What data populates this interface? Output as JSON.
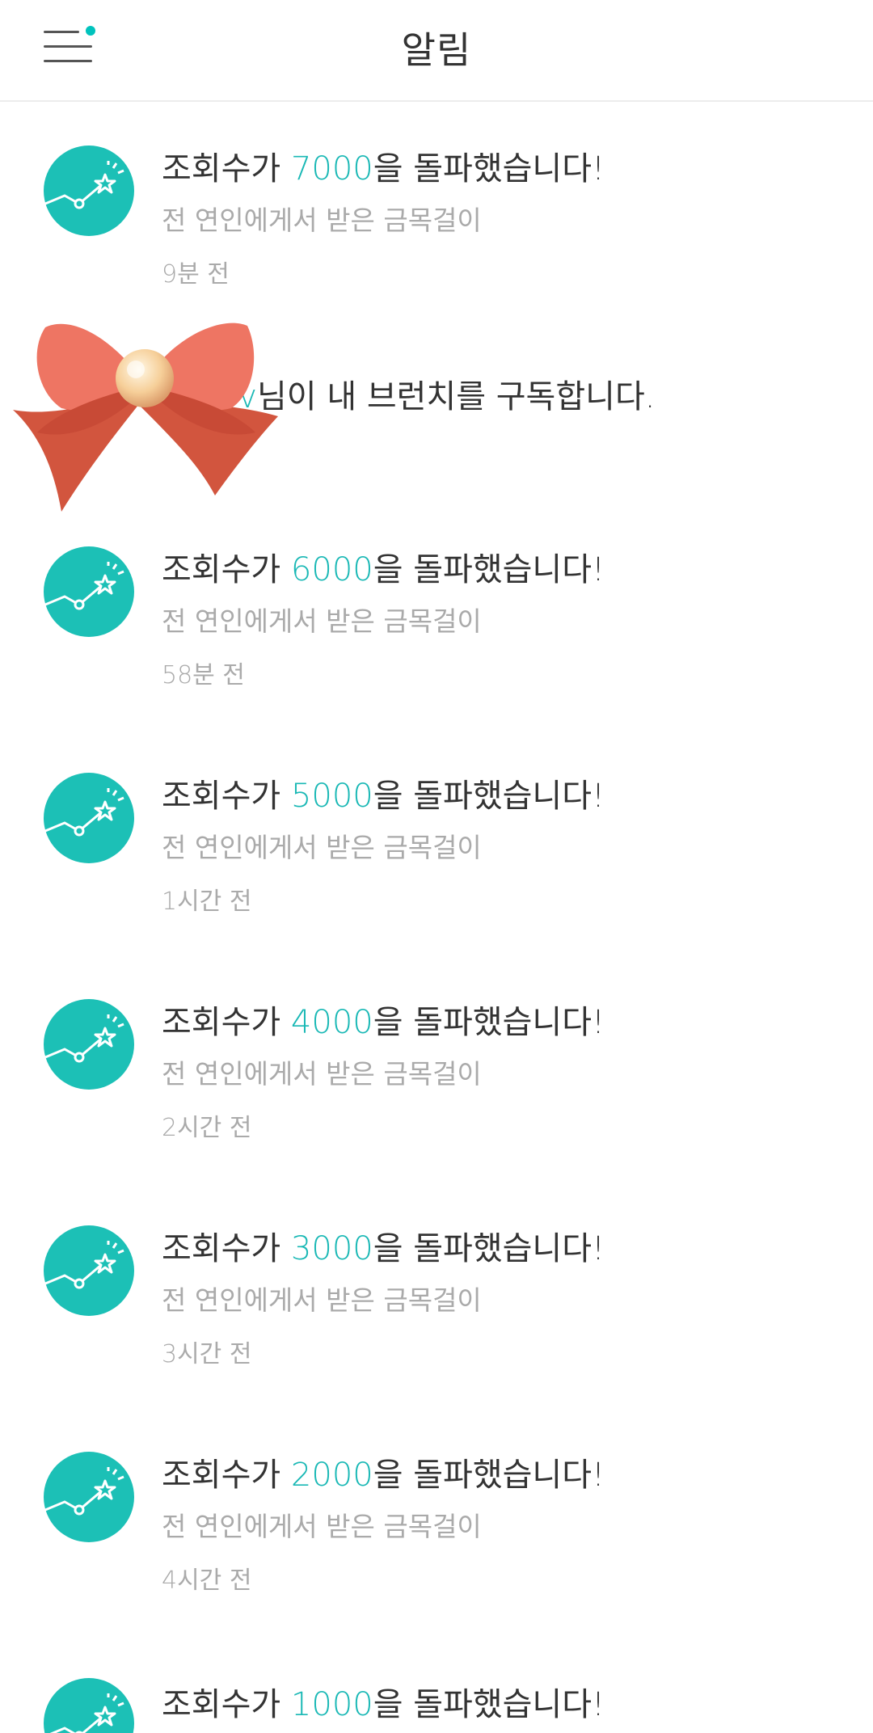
{
  "header": {
    "title": "알림",
    "menu_icon": "hamburger-menu-icon",
    "badge_color": "#00c3bd"
  },
  "colors": {
    "accent": "#19b8b5",
    "avatar": "#1cc0b6",
    "text": "#333333",
    "muted": "#aaaaaa"
  },
  "notifications": [
    {
      "prefix": "조회수가 ",
      "number": "7000",
      "suffix": "을 돌파했습니다!",
      "subtitle": "전 연인에게서 받은 금목걸이",
      "time": "9분 전"
    },
    {
      "name": "v",
      "text": "님이 내 브런치를 구독합니다.",
      "time": ""
    },
    {
      "prefix": "조회수가 ",
      "number": "6000",
      "suffix": "을 돌파했습니다!",
      "subtitle": "전 연인에게서 받은 금목걸이",
      "time": "58분 전"
    },
    {
      "prefix": "조회수가 ",
      "number": "5000",
      "suffix": "을 돌파했습니다!",
      "subtitle": "전 연인에게서 받은 금목걸이",
      "time": "1시간 전"
    },
    {
      "prefix": "조회수가 ",
      "number": "4000",
      "suffix": "을 돌파했습니다!",
      "subtitle": "전 연인에게서 받은 금목걸이",
      "time": "2시간 전"
    },
    {
      "prefix": "조회수가 ",
      "number": "3000",
      "suffix": "을 돌파했습니다!",
      "subtitle": "전 연인에게서 받은 금목걸이",
      "time": "3시간 전"
    },
    {
      "prefix": "조회수가 ",
      "number": "2000",
      "suffix": "을 돌파했습니다!",
      "subtitle": "전 연인에게서 받은 금목걸이",
      "time": "4시간 전"
    },
    {
      "prefix": "조회수가 ",
      "number": "1000",
      "suffix": "을 돌파했습니다!"
    }
  ],
  "decoration": {
    "icon": "ribbon-bow-sticker"
  }
}
